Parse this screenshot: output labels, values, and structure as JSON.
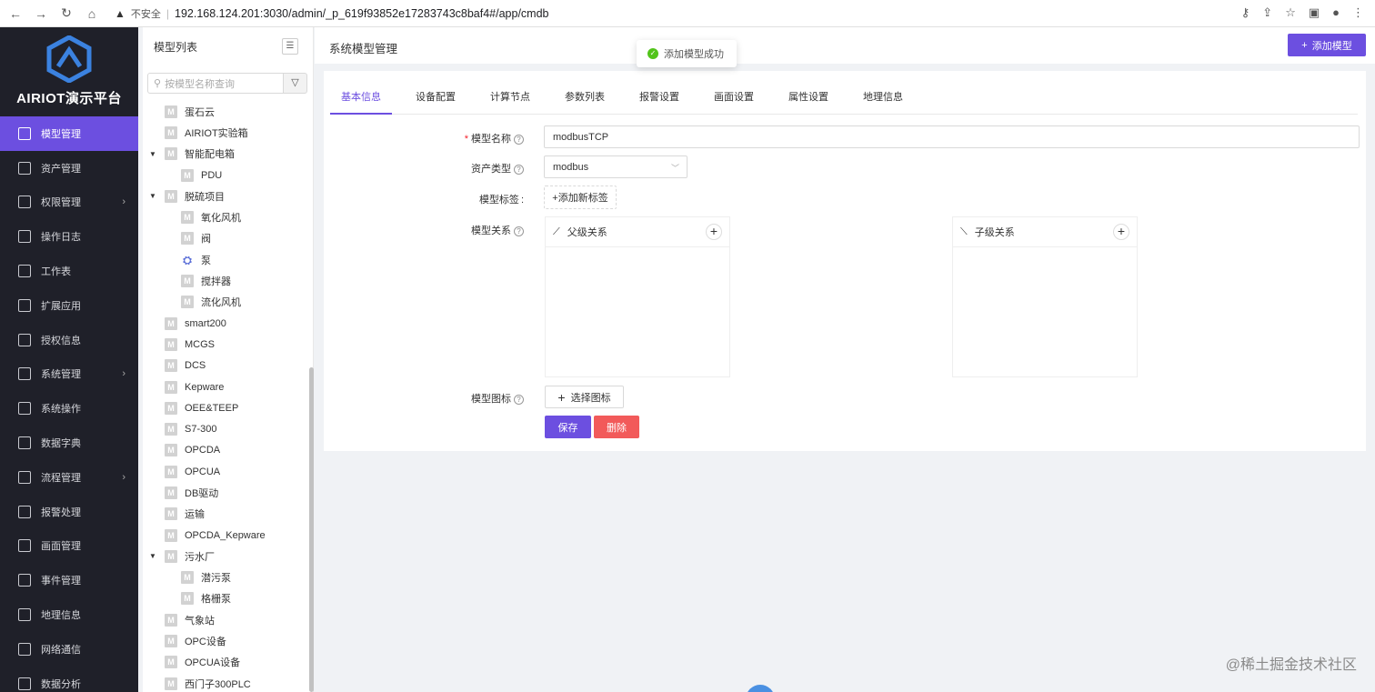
{
  "browser": {
    "security_label": "不安全",
    "url": "192.168.124.201:3030/admin/_p_619f93852e17283743c8baf4#/app/cmdb"
  },
  "brand": {
    "name": "AIRIOT演示平台"
  },
  "sidebar": {
    "items": [
      {
        "label": "模型管理",
        "active": true
      },
      {
        "label": "资产管理"
      },
      {
        "label": "权限管理",
        "arrow": true
      },
      {
        "label": "操作日志"
      },
      {
        "label": "工作表"
      },
      {
        "label": "扩展应用"
      },
      {
        "label": "授权信息"
      },
      {
        "label": "系统管理",
        "arrow": true
      },
      {
        "label": "系统操作"
      },
      {
        "label": "数据字典"
      },
      {
        "label": "流程管理",
        "arrow": true
      },
      {
        "label": "报警处理"
      },
      {
        "label": "画面管理"
      },
      {
        "label": "事件管理"
      },
      {
        "label": "地理信息"
      },
      {
        "label": "网络通信"
      },
      {
        "label": "数据分析"
      }
    ]
  },
  "tree": {
    "title": "模型列表",
    "search_placeholder": "按模型名称查询",
    "nodes": [
      {
        "label": "蛋石云",
        "level": 0
      },
      {
        "label": "AIRIOT实验箱",
        "level": 0
      },
      {
        "label": "智能配电箱",
        "level": 0,
        "expanded": true
      },
      {
        "label": "PDU",
        "level": 1
      },
      {
        "label": "脱硫项目",
        "level": 0,
        "expanded": true
      },
      {
        "label": "氧化风机",
        "level": 1
      },
      {
        "label": "阀",
        "level": 1
      },
      {
        "label": "泵",
        "level": 1,
        "custom_icon": true
      },
      {
        "label": "搅拌器",
        "level": 1
      },
      {
        "label": "流化风机",
        "level": 1
      },
      {
        "label": "smart200",
        "level": 0
      },
      {
        "label": "MCGS",
        "level": 0
      },
      {
        "label": "DCS",
        "level": 0
      },
      {
        "label": "Kepware",
        "level": 0
      },
      {
        "label": "OEE&TEEP",
        "level": 0
      },
      {
        "label": "S7-300",
        "level": 0
      },
      {
        "label": "OPCDA",
        "level": 0
      },
      {
        "label": "OPCUA",
        "level": 0
      },
      {
        "label": "DB驱动",
        "level": 0
      },
      {
        "label": "运输",
        "level": 0
      },
      {
        "label": "OPCDA_Kepware",
        "level": 0
      },
      {
        "label": "污水厂",
        "level": 0,
        "expanded": true
      },
      {
        "label": "潜污泵",
        "level": 1
      },
      {
        "label": "格栅泵",
        "level": 1
      },
      {
        "label": "气象站",
        "level": 0
      },
      {
        "label": "OPC设备",
        "level": 0
      },
      {
        "label": "OPCUA设备",
        "level": 0
      },
      {
        "label": "西门子300PLC",
        "level": 0
      }
    ]
  },
  "main": {
    "title": "系统模型管理",
    "add_button": "添加模型",
    "toast": "添加模型成功",
    "tabs": [
      "基本信息",
      "设备配置",
      "计算节点",
      "参数列表",
      "报警设置",
      "画面设置",
      "属性设置",
      "地理信息"
    ],
    "form": {
      "name_label": "模型名称",
      "name_value": "modbusTCP",
      "type_label": "资产类型",
      "type_value": "modbus",
      "tags_label": "模型标签",
      "tags_add": "+添加新标签",
      "relation_label": "模型关系",
      "parent_rel": "父级关系",
      "child_rel": "子级关系",
      "icon_label": "模型图标",
      "icon_button": "选择图标",
      "save": "保存",
      "delete": "删除"
    }
  },
  "watermark": "@稀土掘金技术社区"
}
